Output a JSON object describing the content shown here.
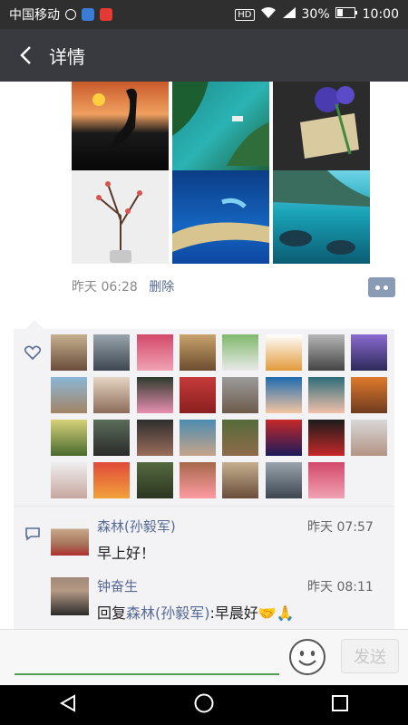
{
  "status": {
    "carrier": "中国移动",
    "network_badge": "HD",
    "battery_percent": "30%",
    "time": "10:00",
    "colors": {
      "bar": "#2f2f2f",
      "text": "#ffffff",
      "icon_green": "#4caf50",
      "icon_red": "#e53935"
    }
  },
  "header": {
    "title": "详情",
    "back_icon": "chevron-left-icon",
    "bg": "#393a3f"
  },
  "post": {
    "photos": [
      {
        "name": "sunset-crane-photo"
      },
      {
        "name": "coast-aerial-photo"
      },
      {
        "name": "lavender-bouquet-photo"
      },
      {
        "name": "plum-blossom-photo"
      },
      {
        "name": "island-aerial-photo"
      },
      {
        "name": "sea-rocks-photo"
      }
    ],
    "time": "昨天 06:28",
    "delete_label": "删除",
    "link_color": "#576b95"
  },
  "likes": {
    "icon": "heart-icon",
    "count": 31
  },
  "comments": [
    {
      "name": "森林(孙毅军)",
      "time": "昨天 07:57",
      "text": "早上好！"
    },
    {
      "name": "钟奋生",
      "time": "昨天 08:11",
      "reply_prefix": "回复",
      "reply_to": "森林(孙毅军)",
      "reply_text": ":早晨好",
      "emoji": "🤝🙏"
    }
  ],
  "bottom": {
    "send_label": "发送",
    "emoji_icon": "smiley-icon"
  },
  "navbar": {
    "back_icon": "triangle-back-icon",
    "home_icon": "circle-home-icon",
    "recents_icon": "square-recents-icon"
  }
}
